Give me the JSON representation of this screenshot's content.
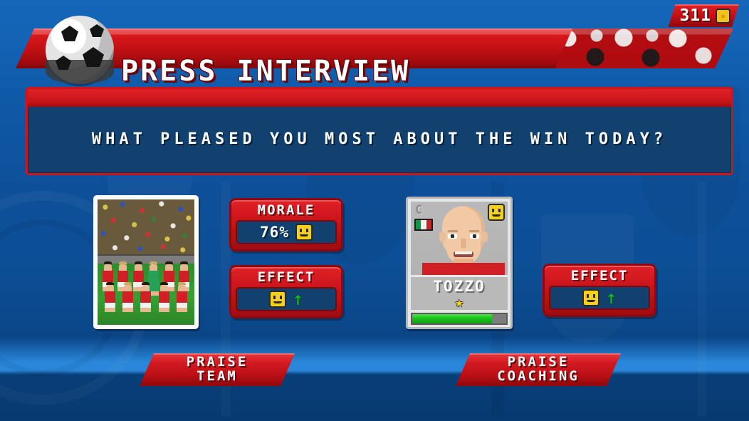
{
  "header": {
    "title": "PRESS INTERVIEW",
    "ball_icon": "soccer-ball-icon"
  },
  "currency": {
    "amount": "311",
    "coin_icon": "gold-coin-icon"
  },
  "question": {
    "text": "WHAT PLEASED YOU MOST ABOUT THE WIN TODAY?"
  },
  "team": {
    "photo_alt": "team-photo"
  },
  "panels": {
    "morale": {
      "label": "MORALE",
      "value": "76%",
      "mood_icon": "smiley-face-icon"
    },
    "effect_team": {
      "label": "EFFECT",
      "mood_icon": "smiley-face-icon",
      "trend_icon": "↑"
    },
    "effect_coach": {
      "label": "EFFECT",
      "mood_icon": "smiley-face-icon",
      "trend_icon": "↑"
    }
  },
  "player_card": {
    "role": "C",
    "nationality_flag": "italy-flag-icon",
    "mood_icon": "smiley-face-icon",
    "name": "TOZZO",
    "star_icon": "★",
    "rating_percent": 85
  },
  "buttons": {
    "praise_team": {
      "line1": "PRAISE",
      "line2": "TEAM"
    },
    "praise_coaching": {
      "line1": "PRAISE",
      "line2": "COACHING"
    }
  },
  "colors": {
    "red": "#cf1318",
    "dark_red": "#8e090d",
    "blue_bg": "#0d5099",
    "navy_panel": "#10416f",
    "green": "#1cc21c",
    "gold": "#f5d01e"
  }
}
